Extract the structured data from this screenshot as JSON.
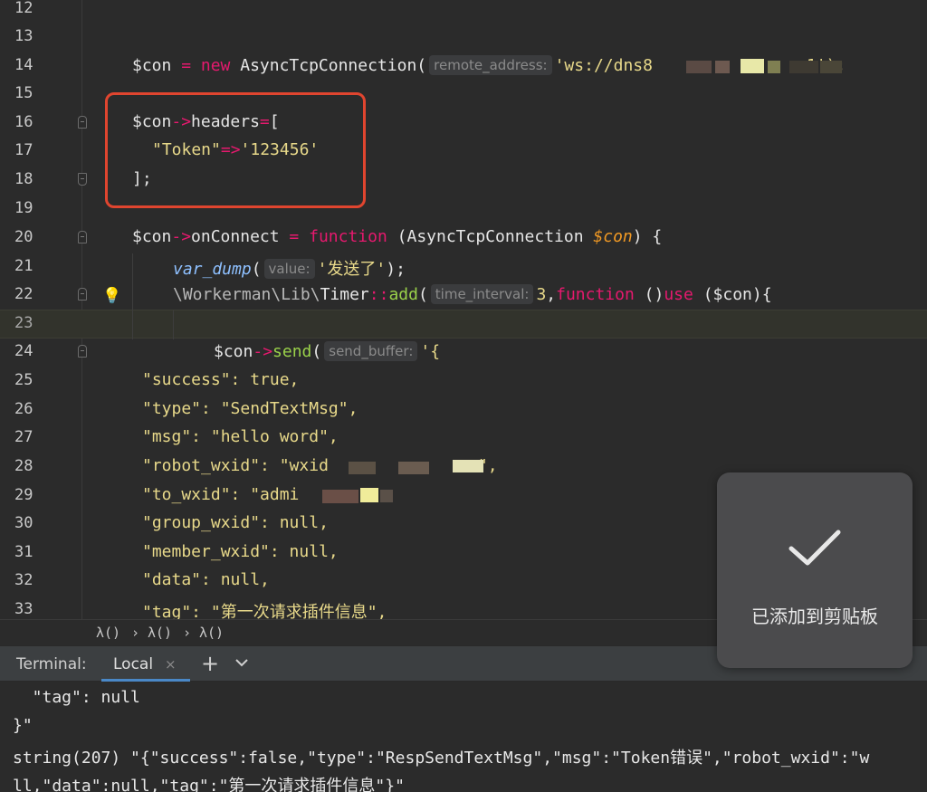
{
  "editor": {
    "line_numbers": [
      "12",
      "13",
      "14",
      "15",
      "16",
      "17",
      "18",
      "19",
      "20",
      "21",
      "22",
      "23",
      "24",
      "25",
      "26",
      "27",
      "28",
      "29",
      "30",
      "31",
      "32",
      "33"
    ],
    "code": {
      "l14": {
        "var": "$con",
        "op": " = ",
        "kw": "new",
        "cls": " AsyncTcpConnection(",
        "hint": "remote_address:",
        "str": "'ws://dns8",
        "tail": "1');"
      },
      "l16": {
        "text": "$con",
        "arrow": "->",
        "prop": "headers",
        "eq": "=",
        "open": "["
      },
      "l17": {
        "key": "\"Token\"",
        "arrow": "=>",
        "val": "'123456'"
      },
      "l18": {
        "text": "];"
      },
      "l20": {
        "var": "$con",
        "arrow": "->",
        "prop": "onConnect",
        "eq": " = ",
        "kw": "function",
        "params1": " (AsyncTcpConnection ",
        "pvar": "$con",
        "params2": ") {"
      },
      "l21": {
        "fn": "var_dump",
        "paren": "(",
        "hint": "value:",
        "str": "'发送了'",
        "end": ");"
      },
      "l22": {
        "ns": "\\Workerman\\Lib\\",
        "cls": "Timer",
        "sep": "::",
        "fn": "add",
        "paren": "(",
        "hint": "time_interval:",
        "num": "3",
        "comma": ",",
        "kw": "function",
        "mid": " ()",
        "use": "use",
        "tail": " ($con){"
      },
      "l24": {
        "var": "$con",
        "arrow": "->",
        "fn": "send",
        "paren": "(",
        "hint": "send_buffer:",
        "str": "'{"
      },
      "l25": "\"success\": true,",
      "l26": "\"type\": \"SendTextMsg\",",
      "l27": "\"msg\": \"hello word\",",
      "l28a": "\"robot_wxid\": \"wxid",
      "l28b": "\",",
      "l29": "\"to_wxid\": \"admi",
      "l30": "\"group_wxid\": null,",
      "l31": "\"member_wxid\": null,",
      "l32": "\"data\": null,",
      "l33": "\"tag\": \"第一次请求插件信息\","
    }
  },
  "breadcrumb": [
    "λ()",
    "›",
    "λ()",
    "›",
    "λ()"
  ],
  "terminal": {
    "label": "Terminal:",
    "tab": "Local",
    "close": "×",
    "add": "+",
    "lines": [
      "  \"tag\": null",
      "}\"",
      "string(207) \"{\"success\":false,\"type\":\"RespSendTextMsg\",\"msg\":\"Token错误\",\"robot_wxid\":\"w",
      "ll,\"data\":null,\"tag\":\"第一次请求插件信息\"}\""
    ]
  },
  "toast": {
    "message": "已添加到剪贴板"
  },
  "colors": {
    "editor_bg": "#2b2b2b",
    "keyword": "#e6196e",
    "string": "#e8d98a",
    "function": "#9ad14a",
    "highlight_box": "#e0452f",
    "tab_underline": "#4a88c7"
  }
}
